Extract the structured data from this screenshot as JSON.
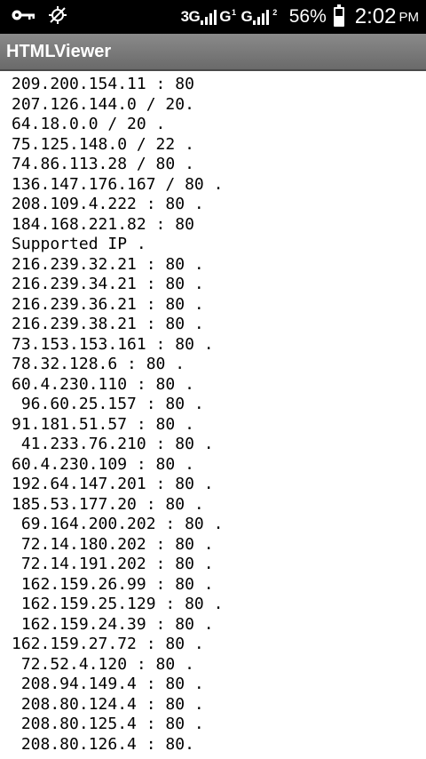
{
  "status_bar": {
    "network_label": "3G",
    "sim1_label": "G",
    "sim1_sup": "1",
    "sim2_label": "G",
    "sim2_sup": "2",
    "battery_percent": "56%",
    "battery_level": 0.56,
    "time": "2:02",
    "ampm": "PM",
    "icons": [
      "key-icon",
      "no-location-icon",
      "signal-icon",
      "battery-icon"
    ]
  },
  "action_bar": {
    "title": "HTMLViewer"
  },
  "content": {
    "lines": [
      "209.200.154.11 : 80",
      "207.126.144.0 / 20.",
      "64.18.0.0 / 20 .",
      "75.125.148.0 / 22 .",
      "74.86.113.28 / 80 .",
      "136.147.176.167 / 80 .",
      "208.109.4.222 : 80 .",
      "184.168.221.82 : 80",
      "Supported IP .",
      "216.239.32.21 : 80 .",
      "216.239.34.21 : 80 .",
      "216.239.36.21 : 80 .",
      "216.239.38.21 : 80 .",
      "73.153.153.161 : 80 .",
      "78.32.128.6 : 80 .",
      "60.4.230.110 : 80 .",
      " 96.60.25.157 : 80 .",
      "91.181.51.57 : 80 .",
      " 41.233.76.210 : 80 .",
      "60.4.230.109 : 80 .",
      "192.64.147.201 : 80 .",
      "185.53.177.20 : 80 .",
      " 69.164.200.202 : 80 .",
      " 72.14.180.202 : 80 .",
      " 72.14.191.202 : 80 .",
      " 162.159.26.99 : 80 .",
      " 162.159.25.129 : 80 .",
      " 162.159.24.39 : 80 .",
      "162.159.27.72 : 80 .",
      " 72.52.4.120 : 80 .",
      " 208.94.149.4 : 80 .",
      " 208.80.124.4 : 80 .",
      " 208.80.125.4 : 80 .",
      " 208.80.126.4 : 80."
    ]
  }
}
